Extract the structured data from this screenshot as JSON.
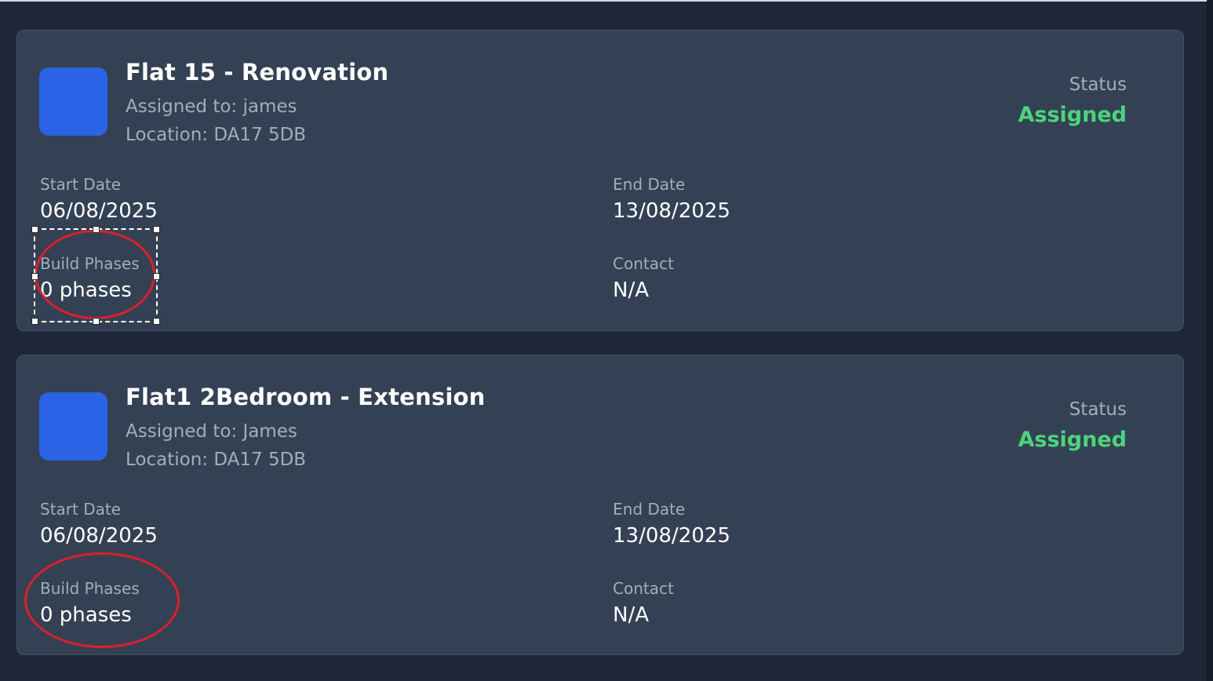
{
  "projects": [
    {
      "title": "Flat 15 - Renovation",
      "assigned_to": "Assigned to: james",
      "location": "Location: DA17 5DB",
      "status_label": "Status",
      "status": "Assigned",
      "start_date_label": "Start Date",
      "start_date": "06/08/2025",
      "end_date_label": "End Date",
      "end_date": "13/08/2025",
      "build_phases_label": "Build Phases",
      "build_phases": "0 phases",
      "contact_label": "Contact",
      "contact": "N/A"
    },
    {
      "title": "Flat1 2Bedroom - Extension",
      "assigned_to": "Assigned to: James",
      "location": "Location: DA17 5DB",
      "status_label": "Status",
      "status": "Assigned",
      "start_date_label": "Start Date",
      "start_date": "06/08/2025",
      "end_date_label": "End Date",
      "end_date": "13/08/2025",
      "build_phases_label": "Build Phases",
      "build_phases": "0 phases",
      "contact_label": "Contact",
      "contact": "N/A"
    }
  ],
  "colors": {
    "background": "#1e2738",
    "card": "#344154",
    "thumbnail": "#2a63e6",
    "status_assigned": "#4cd47a",
    "annotation": "#dd1f2a"
  }
}
